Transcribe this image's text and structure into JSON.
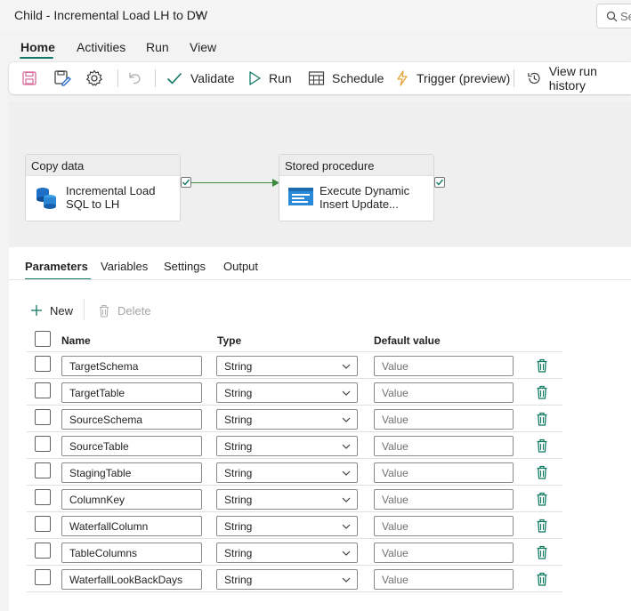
{
  "window": {
    "title": "Child - Incremental Load LH to DW",
    "search_text": "Se"
  },
  "menu_tabs": [
    {
      "label": "Home",
      "active": true
    },
    {
      "label": "Activities"
    },
    {
      "label": "Run"
    },
    {
      "label": "View"
    }
  ],
  "toolbar": {
    "save_icon": "save-icon",
    "save_as_icon": "save-as-icon",
    "settings_icon": "gear-icon",
    "undo_icon": "undo-icon",
    "validate_label": "Validate",
    "run_label": "Run",
    "schedule_label": "Schedule",
    "trigger_label": "Trigger (preview)",
    "view_run_history_label": "View run history"
  },
  "pipeline": {
    "activities": [
      {
        "type": "Copy data",
        "name_line1": "Incremental Load",
        "name_line2": "SQL to LH",
        "icon": "copy-data-icon"
      },
      {
        "type": "Stored procedure",
        "name_line1": "Execute Dynamic",
        "name_line2": "Insert Update...",
        "icon": "stored-procedure-icon"
      }
    ],
    "connector_color": "#3b8a3e"
  },
  "panel": {
    "tabs": [
      {
        "label": "Parameters",
        "active": true
      },
      {
        "label": "Variables"
      },
      {
        "label": "Settings"
      },
      {
        "label": "Output"
      }
    ],
    "new_label": "New",
    "delete_label": "Delete",
    "columns": {
      "name": "Name",
      "type": "Type",
      "default": "Default value"
    },
    "value_placeholder": "Value",
    "parameters": [
      {
        "name": "TargetSchema",
        "type": "String"
      },
      {
        "name": "TargetTable",
        "type": "String"
      },
      {
        "name": "SourceSchema",
        "type": "String"
      },
      {
        "name": "SourceTable",
        "type": "String"
      },
      {
        "name": "StagingTable",
        "type": "String"
      },
      {
        "name": "ColumnKey",
        "type": "String"
      },
      {
        "name": "WaterfallColumn",
        "type": "String"
      },
      {
        "name": "TableColumns",
        "type": "String"
      },
      {
        "name": "WaterfallLookBackDays",
        "type": "String"
      }
    ]
  },
  "colors": {
    "accent": "#117865",
    "delete_icon": "#0e7a5f"
  }
}
